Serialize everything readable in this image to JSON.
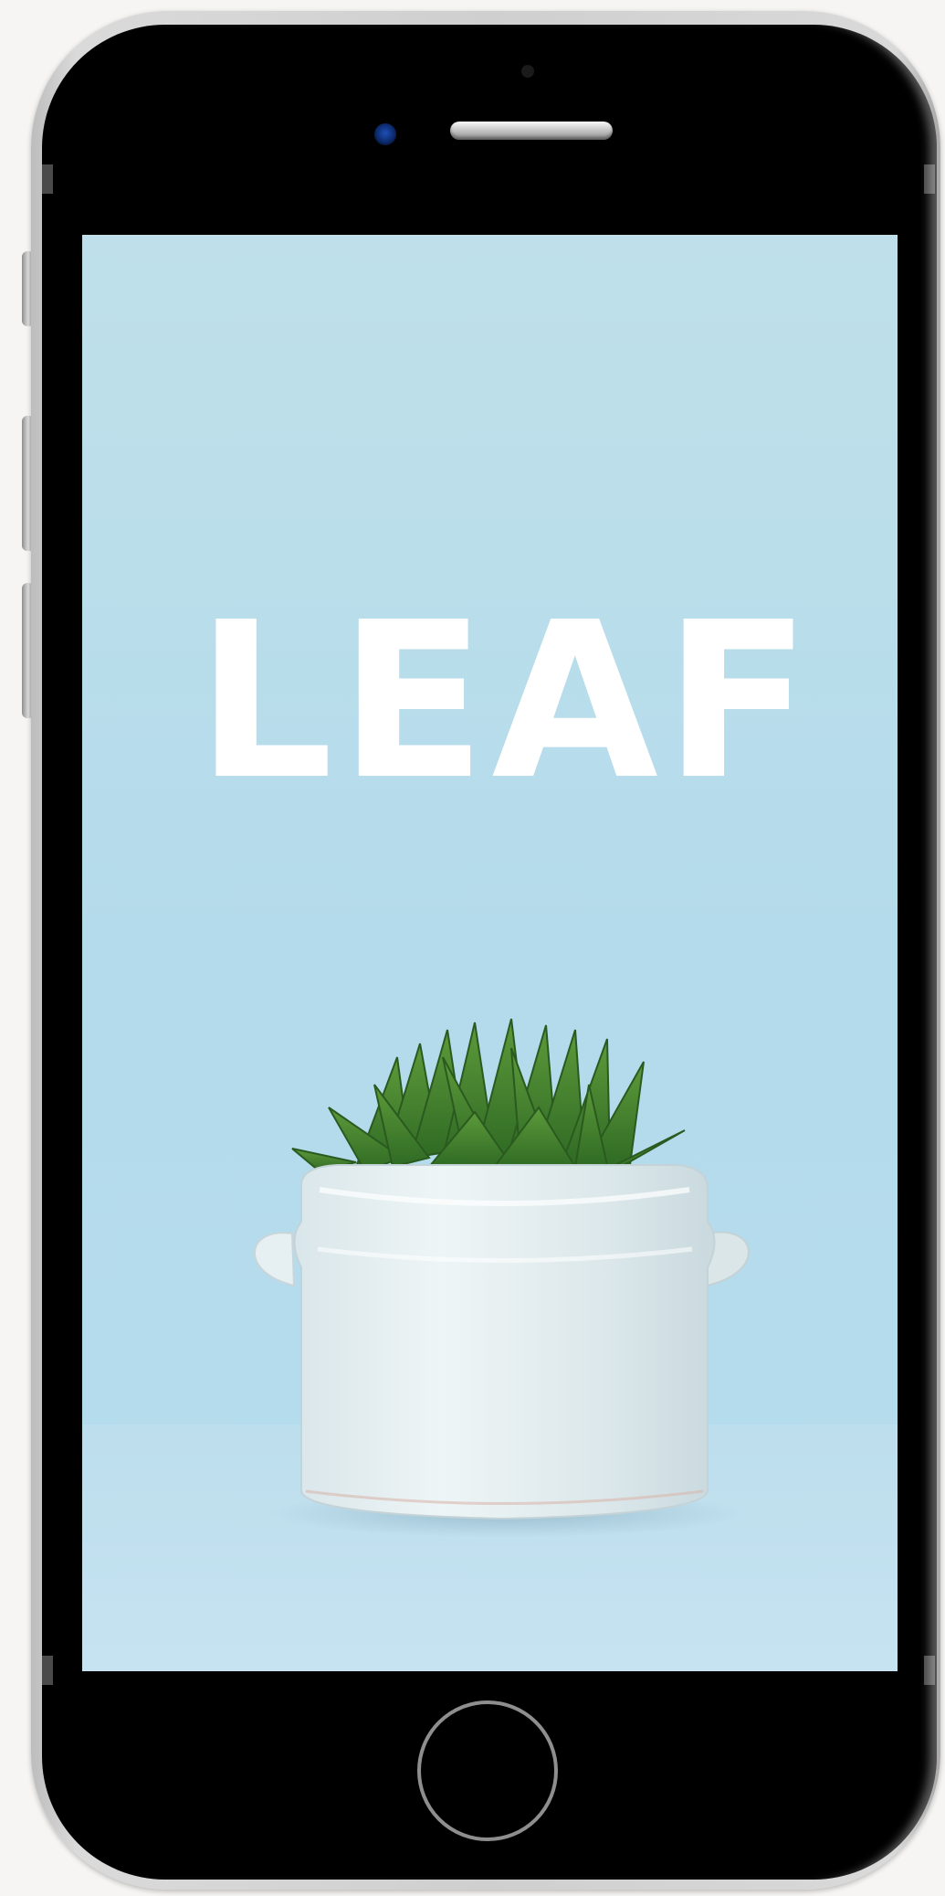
{
  "screen": {
    "app_title": "LEAF",
    "background_color": "#b8dcec",
    "image_subject": "potted-succulent"
  },
  "device": {
    "icons": {
      "front_camera": "front-camera-icon",
      "proximity_sensor": "proximity-sensor-icon",
      "speaker": "speaker-grille-icon",
      "home": "home-button-icon"
    }
  }
}
